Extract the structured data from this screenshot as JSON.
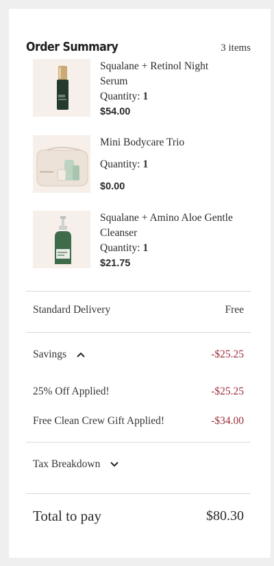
{
  "order_summary": {
    "title": "Order Summary",
    "item_count": "3 items"
  },
  "items": [
    {
      "name": "Squalane + Retinol Night Serum",
      "quantity_label": "Quantity:",
      "quantity": "1",
      "price": "$54.00",
      "image": "serum-bottle"
    },
    {
      "name": "Mini Bodycare Trio",
      "quantity_label": "Quantity:",
      "quantity": "1",
      "price": "$0.00",
      "image": "bodycare-pouch"
    },
    {
      "name": "Squalane + Amino Aloe Gentle Cleanser",
      "quantity_label": "Quantity:",
      "quantity": "1",
      "price": "$21.75",
      "image": "cleanser-pump-bottle"
    }
  ],
  "delivery": {
    "label": "Standard Delivery",
    "value": "Free"
  },
  "savings": {
    "label": "Savings",
    "value": "-$25.25",
    "icon": "chevron-up-icon",
    "lines": [
      {
        "label": "25% Off Applied!",
        "value": "-$25.25"
      },
      {
        "label": "Free Clean Crew Gift Applied!",
        "value": "-$34.00"
      }
    ]
  },
  "tax": {
    "label": "Tax Breakdown",
    "icon": "chevron-down-icon"
  },
  "total": {
    "label": "Total to pay",
    "value": "$80.30"
  },
  "colors": {
    "negative": "#9b2b3a",
    "thumb_bg": "#f7efe9",
    "page_bg": "#efefef"
  }
}
